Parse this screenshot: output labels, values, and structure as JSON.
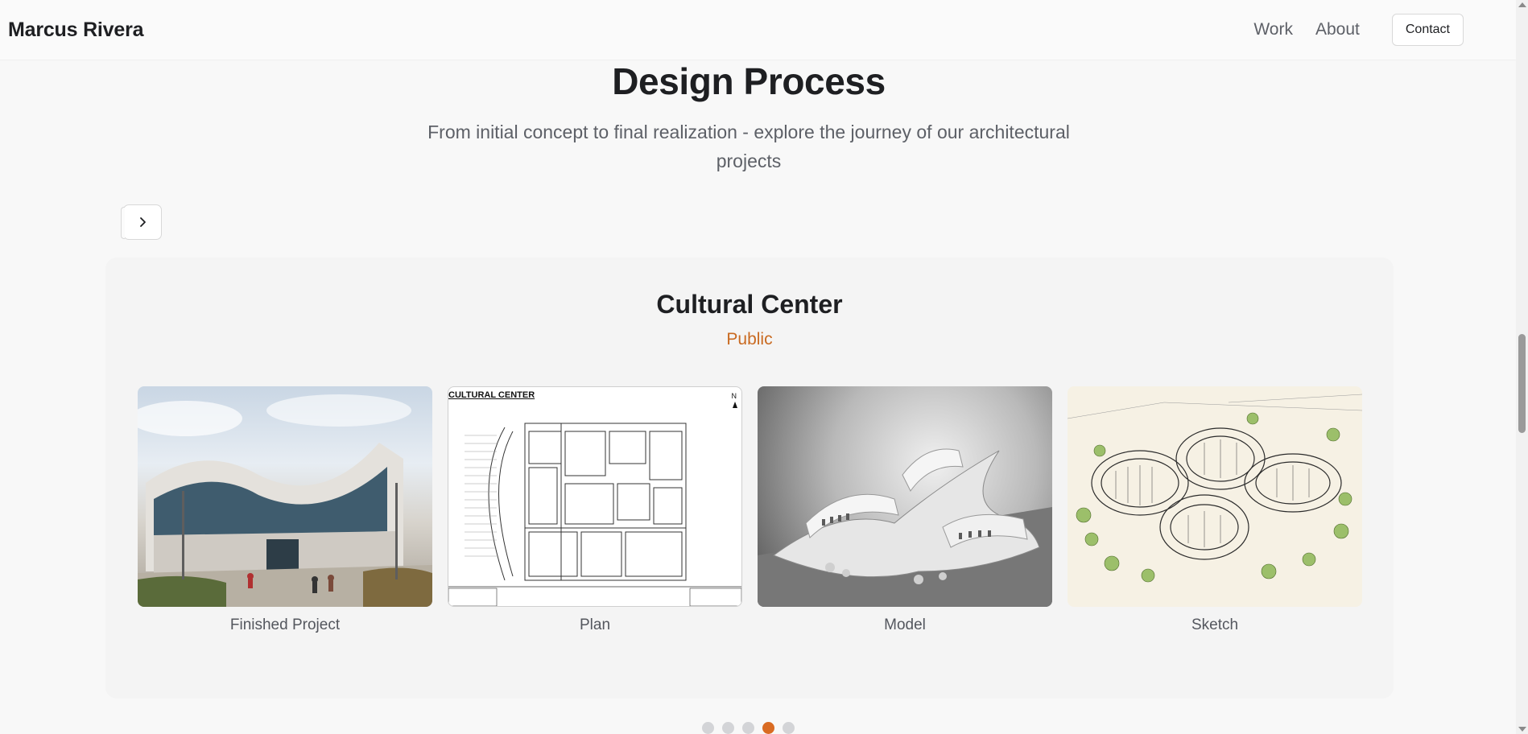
{
  "header": {
    "brand": "Marcus Rivera",
    "nav": [
      {
        "label": "Work"
      },
      {
        "label": "About"
      }
    ],
    "contact_label": "Contact"
  },
  "section": {
    "title": "Design Process",
    "subtitle": "From initial concept to final realization - explore the journey of our architectural projects"
  },
  "carousel": {
    "next_icon": "chevron-right-icon",
    "slide_count": 5,
    "active_index": 3
  },
  "project": {
    "title": "Cultural Center",
    "category": "Public",
    "stages": [
      {
        "label": "Finished Project"
      },
      {
        "label": "Plan",
        "plan_title": "CULTURAL CENTER"
      },
      {
        "label": "Model"
      },
      {
        "label": "Sketch"
      }
    ]
  },
  "colors": {
    "accent": "#d96b23",
    "category": "#c96a21",
    "text": "#1e1f22",
    "muted": "#5d6067"
  }
}
